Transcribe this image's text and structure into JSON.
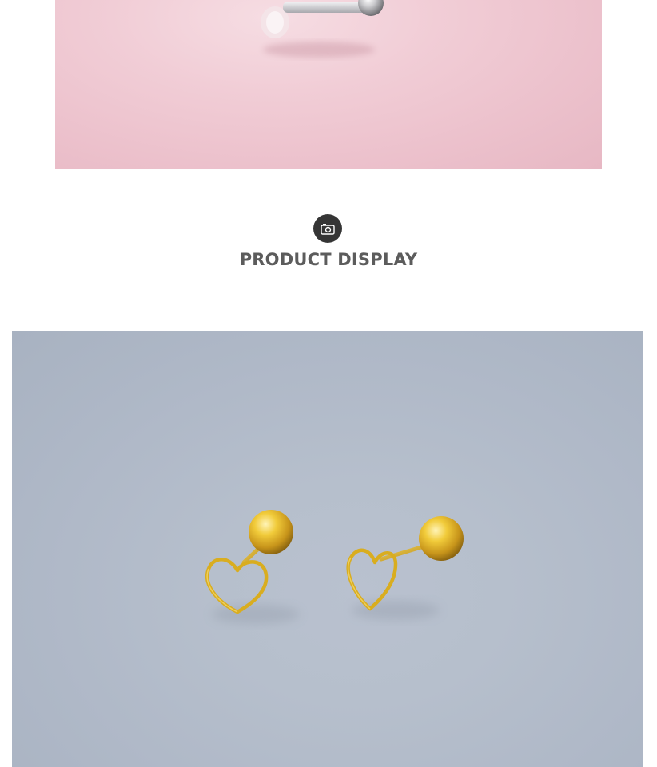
{
  "section": {
    "icon": "camera-icon",
    "title": "PRODUCT DISPLAY"
  },
  "images": {
    "top": "pink-background-earring-photo",
    "main": "gold-heart-stud-earrings-photo"
  },
  "colors": {
    "badge": "#353535",
    "title_text": "#5c5c5c",
    "pink_bg": "#ecc1cc",
    "blue_bg": "#b3bccb",
    "gold": "#e0b21c"
  }
}
